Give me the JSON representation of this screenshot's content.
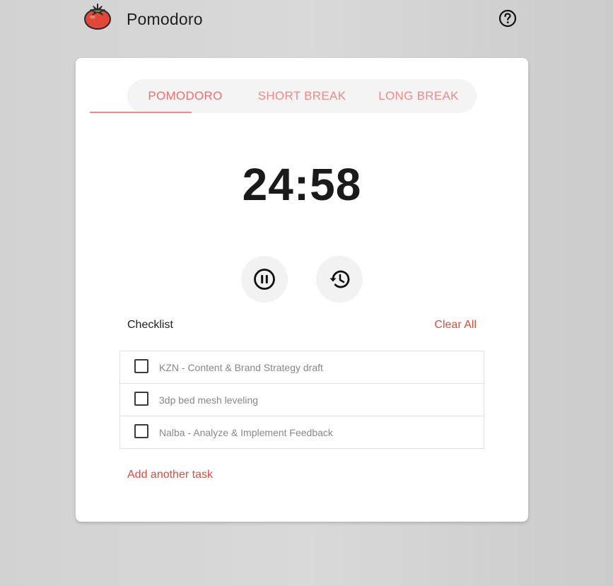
{
  "header": {
    "app_title": "Pomodoro",
    "logo_icon": "tomato-icon",
    "help_icon": "question-circle-icon"
  },
  "tabs": [
    {
      "label": "POMODORO",
      "active": true
    },
    {
      "label": "SHORT BREAK",
      "active": false
    },
    {
      "label": "LONG BREAK",
      "active": false
    }
  ],
  "timer": {
    "display": "24:58"
  },
  "controls": {
    "pause_icon": "pause-icon",
    "reset_icon": "history-icon"
  },
  "checklist": {
    "title": "Checklist",
    "clear_all_label": "Clear All",
    "tasks": [
      {
        "label": "KZN - Content & Brand Strategy draft",
        "checked": false
      },
      {
        "label": "3dp bed mesh leveling",
        "checked": false
      },
      {
        "label": "Nalba - Analyze & Implement Feedback",
        "checked": false
      }
    ],
    "add_task_label": "Add another task"
  },
  "colors": {
    "accent": "#e24a3b",
    "tab_text": "#f08a8a",
    "card": "#ffffff"
  }
}
